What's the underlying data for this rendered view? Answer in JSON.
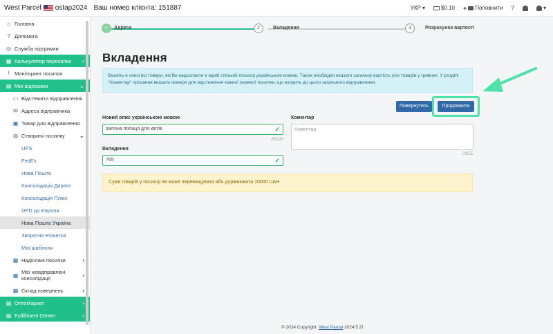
{
  "topbar": {
    "brand": "West Parcel",
    "username": "ostap2024",
    "client_number": "Ваш номер клієнта: 151887",
    "lang": "УКР",
    "balance": "$0.10",
    "topup": "Поповнити",
    "help": "?"
  },
  "sidebar": {
    "items": [
      {
        "label": "Головна",
        "icon": "home-icon"
      },
      {
        "label": "Допомога",
        "icon": "help-icon"
      },
      {
        "label": "Служба підтримки",
        "icon": "support-icon"
      },
      {
        "label": "Калькулятор пересилки",
        "icon": "calculator-icon"
      },
      {
        "label": "Моніторинг посилок",
        "icon": "alert-icon"
      },
      {
        "label": "Мої відправки",
        "icon": "shipments-icon"
      },
      {
        "label": "Відстежити відправлення",
        "icon": "track-icon"
      },
      {
        "label": "Адреса відправника",
        "icon": "address-icon"
      },
      {
        "label": "Товар для відправлення",
        "icon": "box-icon"
      },
      {
        "label": "Створити посилку",
        "icon": "create-icon"
      },
      {
        "label": "UPS"
      },
      {
        "label": "FedEx"
      },
      {
        "label": "Нова Пошта"
      },
      {
        "label": "Консолідація Директ"
      },
      {
        "label": "Консолідація Плюс"
      },
      {
        "label": "DPD до Європи"
      },
      {
        "label": "Нова Пошта Україна"
      },
      {
        "label": "Зворотня етикетка"
      },
      {
        "label": "Мої шаблони"
      },
      {
        "label": "Надіслані посилки",
        "icon": "sent-icon"
      },
      {
        "label": "Мої невідправлені консолідації",
        "icon": "unsent-icon"
      },
      {
        "label": "Склад повернень",
        "icon": "warehouse-icon"
      },
      {
        "label": "ОптоМаркет",
        "icon": "cart-icon"
      },
      {
        "label": "Fulfillment Center",
        "icon": "fulfillment-icon"
      }
    ]
  },
  "steps": {
    "step1": "Адреса",
    "step2_num": "2",
    "step2": "Вкладення",
    "step3_num": "3",
    "step3": "Розрахунок вартості"
  },
  "page": {
    "title": "Вкладення",
    "info": "Вкажіть в описі всі товари, які Ви надсилаєте в одній спільній посилці українською мовою. Також необхідно вказати загальну вартість усіх товарів у гривнях. У розділі \"Коментар\" прохання вказати номери для відстеження кожної окремої посилки, що входить до цього загального відправлення.",
    "back_button": "Повернутись",
    "next_button": "Продовжити",
    "desc_label": "Новий опис українською мовою",
    "desc_value": "залізна полиця для квітів",
    "desc_counter": "25/120",
    "comment_label": "Коментар",
    "comment_placeholder": "Коментар",
    "comment_counter": "0/255",
    "contents_label": "Вкладення",
    "contents_value": "765",
    "warning": "Сума товарів у посилці не може перевищувати або дорівнювати 10000 UAH"
  },
  "footer": {
    "text": "© 2024 Copyright:",
    "link": "West Parcel",
    "version": "2024.5.2f"
  },
  "colors": {
    "accent_green": "#21c08b",
    "primary_blue": "#2f69a8",
    "highlight": "#4fe2a8"
  }
}
